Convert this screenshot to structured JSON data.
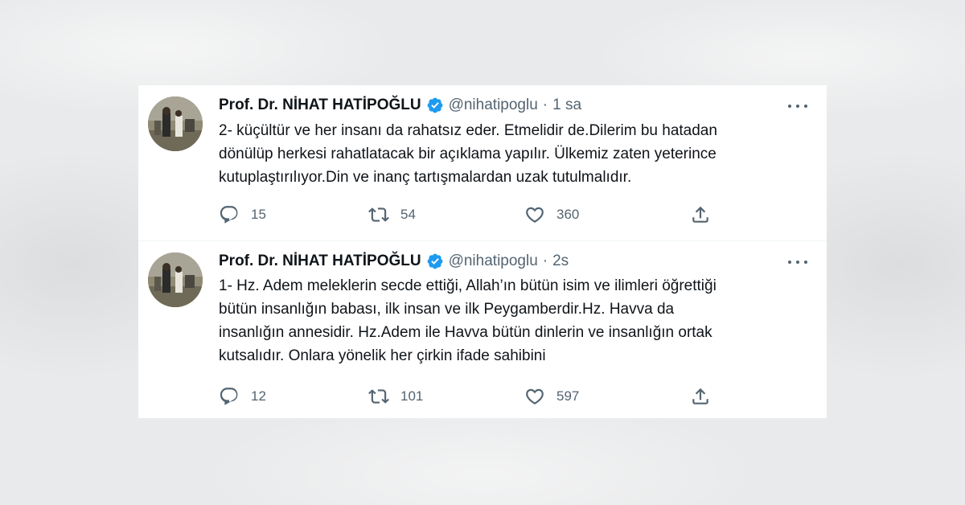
{
  "tweets": [
    {
      "author": "Prof. Dr. NİHAT HATİPOĞLU",
      "handle": "@nihatipoglu",
      "separator": "·",
      "time": "1 sa",
      "lines": [
        "2- küçültür ve her insanı da rahatsız eder. Etmelidir de.Dilerim bu hatadan",
        "dönülüp herkesi rahatlatacak bir açıklama yapılır. Ülkemiz zaten yeterince",
        "kutuplaştırılıyor.Din ve inanç tartışmalardan uzak tutulmalıdır."
      ],
      "replies": "15",
      "retweets": "54",
      "likes": "360"
    },
    {
      "author": "Prof. Dr. NİHAT HATİPOĞLU",
      "handle": "@nihatipoglu",
      "separator": "·",
      "time": "2s",
      "lines": [
        "1- Hz. Adem meleklerin secde ettiği, Allah’ın bütün isim ve ilimleri öğrettiği",
        "bütün insanlığın babası, ilk insan ve ilk Peygamberdir.Hz. Havva da",
        "insanlığın annesidir. Hz.Adem ile Havva bütün dinlerin ve insanlığın ortak",
        "kutsalıdır. Onlara yönelik her çirkin ifade sahibini"
      ],
      "replies": "12",
      "retweets": "101",
      "likes": "597"
    }
  ],
  "icons": {
    "verified": "verified-badge-icon",
    "more": "more-icon",
    "reply": "reply-icon",
    "retweet": "retweet-icon",
    "like": "like-icon",
    "share": "share-icon"
  },
  "colors": {
    "verified": "#1d9bf0",
    "text": "#0f1419",
    "muted": "#536471"
  }
}
